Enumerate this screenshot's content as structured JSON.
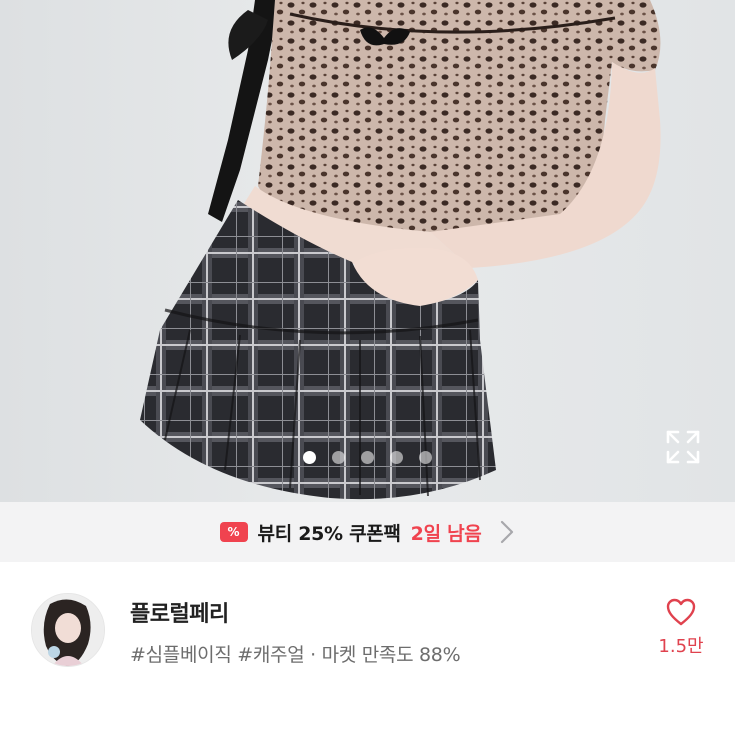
{
  "gallery": {
    "total_images": 5,
    "current_index": 1,
    "expand_icon": "expand-icon"
  },
  "coupon": {
    "icon": "coupon-percent-icon",
    "icon_text": "%",
    "label": "뷰티 25% 쿠폰팩",
    "remaining": "2일 남음",
    "arrow_icon": "chevron-right-icon",
    "accent_color": "#f0434f"
  },
  "shop": {
    "name": "플로럴페리",
    "tags": "#심플베이직 #캐주얼 · 마켓 만족도 88%",
    "like_icon": "heart-outline-icon",
    "like_count": "1.5만",
    "like_color": "#e0424e"
  }
}
